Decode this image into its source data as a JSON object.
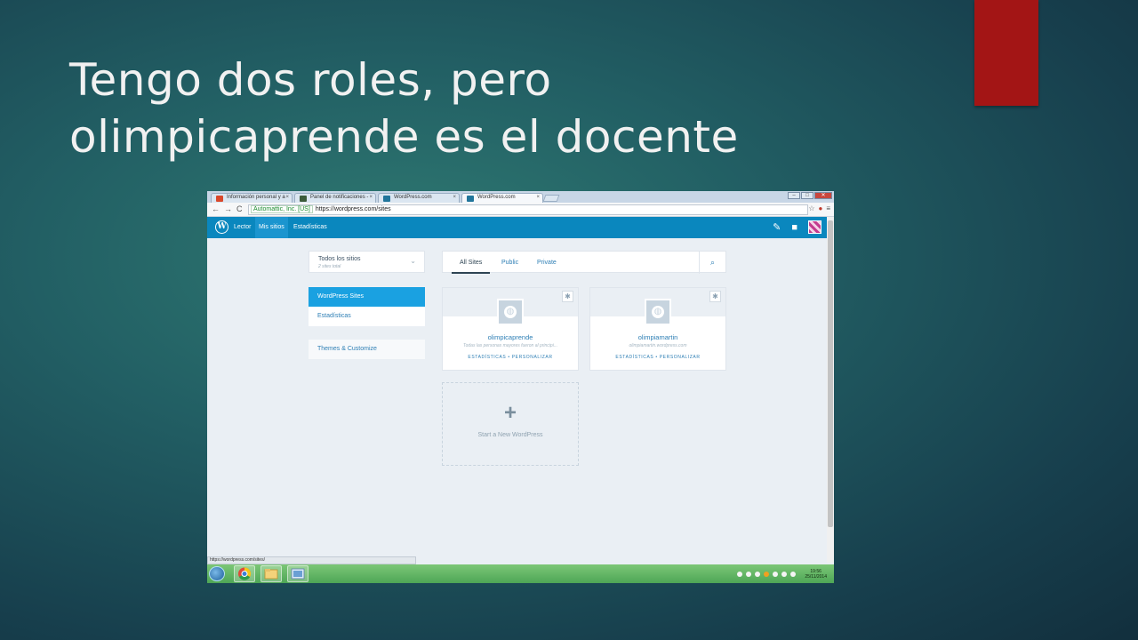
{
  "slide": {
    "title_line1": "Tengo dos roles, pero",
    "title_line2": "olimpicaprende es el docente"
  },
  "browser": {
    "tabs": [
      {
        "label": "Información personal y a",
        "favicon_color": "#d9482b"
      },
      {
        "label": "Panel de notificaciones -",
        "favicon_color": "#3b5b3a"
      },
      {
        "label": "WordPress.com",
        "favicon_color": "#21759b"
      },
      {
        "label": "WordPress.com",
        "favicon_color": "#21759b"
      }
    ],
    "tab_close": "×",
    "ev_label": "Automattic, Inc. [US]",
    "url": "https://wordpress.com/sites",
    "status_url": "https://wordpress.com/sites/"
  },
  "masterbar": {
    "logo": "W",
    "reader": "Lector",
    "my_sites": "Mis sitios",
    "stats": "Estadísticas",
    "colors": {
      "bar": "#0a87be",
      "active": "#1b95cf"
    }
  },
  "sidebar": {
    "selector_title": "Todos los sitios",
    "selector_subtitle": "2 sites total",
    "items": [
      "WordPress Sites",
      "Estadísticas"
    ],
    "themes": "Themes & Customize"
  },
  "filter": {
    "tabs": [
      "All Sites",
      "Public",
      "Private"
    ]
  },
  "sites": [
    {
      "name": "olimpicaprende",
      "description": "Todas las personas mayores fueron al principi...",
      "action_stats": "ESTADÍSTICAS",
      "separator": "•",
      "action_customize": "PERSONALIZAR"
    },
    {
      "name": "olimpiamartin",
      "description": "olimpiamartin.wordpress.com",
      "action_stats": "ESTADÍSTICAS",
      "separator": "•",
      "action_customize": "PERSONALIZAR"
    }
  ],
  "new_site": {
    "plus": "+",
    "label": "Start a New WordPress"
  },
  "taskbar": {
    "time": "19:56",
    "date": "25/11/2014"
  },
  "icons": {
    "search": "search-icon",
    "gear": "gear-icon",
    "globe": "globe-icon",
    "compose": "compose-icon",
    "notifications": "notifications-icon"
  }
}
